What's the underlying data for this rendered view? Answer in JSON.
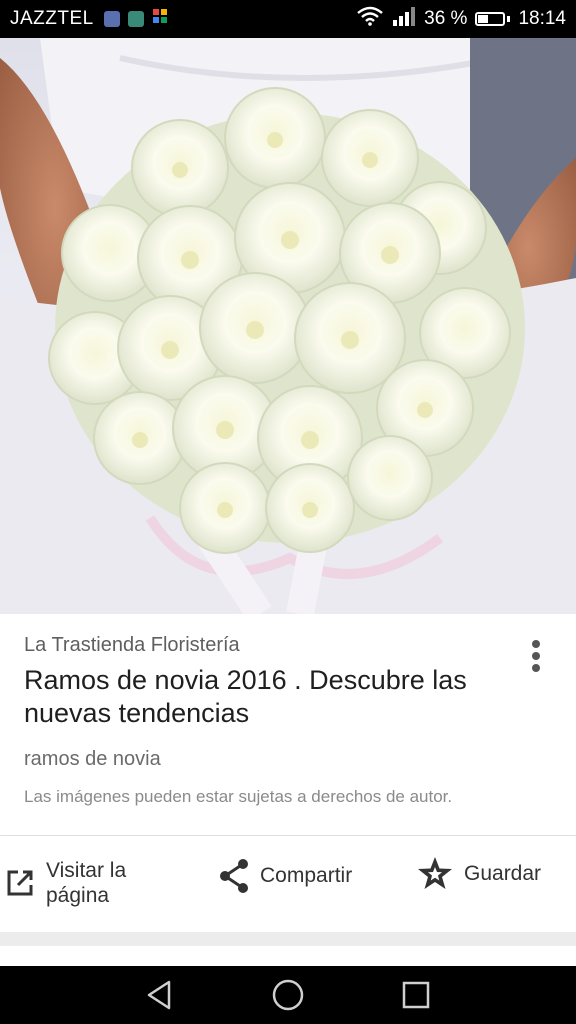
{
  "status_bar": {
    "carrier": "JAZZTEL",
    "battery_percent_text": "36 %",
    "battery_level": 0.36,
    "time": "18:14",
    "icons": [
      "notification-app-icon",
      "gallery-icon",
      "play-store-icon",
      "wifi-icon",
      "signal-icon",
      "battery-icon"
    ]
  },
  "result": {
    "source": "La Trastienda Floristería",
    "title": "Ramos de novia 2016 . Descubre las nuevas tendencias",
    "subtitle": "ramos de novia",
    "rights_notice": "Las imágenes pueden estar sujetas a derechos de autor."
  },
  "actions": {
    "visit_label": "Visitar la página",
    "share_label": "Compartir",
    "save_label": "Guardar"
  },
  "nav_bar": {
    "icons": [
      "back-icon",
      "home-icon",
      "recents-icon"
    ]
  },
  "colors": {
    "status_bar_bg": "#000000",
    "card_bg": "#ffffff",
    "title_text": "#1f1f1f",
    "secondary_text": "#5f5f5f",
    "icon_color": "#333333"
  }
}
